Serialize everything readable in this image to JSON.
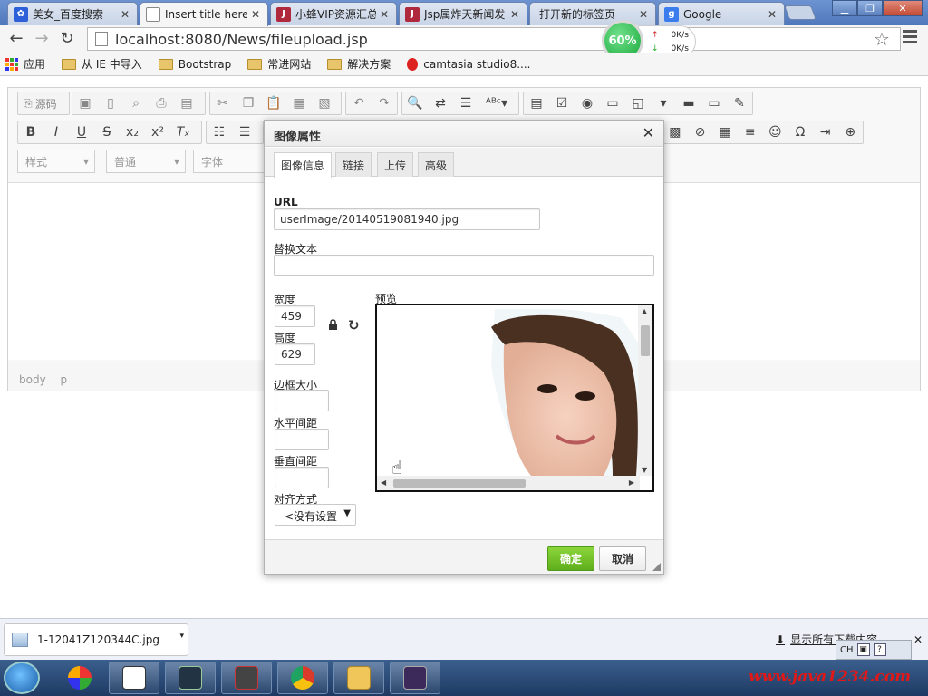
{
  "tabs": [
    {
      "label": "美女_百度搜索",
      "icon": "baidu-paw-icon",
      "color": "#2d5fd8"
    },
    {
      "label": "Insert title here",
      "icon": "page-icon",
      "color": "#ffffff"
    },
    {
      "label": "小蜂VIP资源汇总",
      "icon": "j-icon",
      "color": "#b0283c"
    },
    {
      "label": "Jsp属炸天新闻发",
      "icon": "j-icon",
      "color": "#b0283c"
    },
    {
      "label": "打开新的标签页",
      "icon": "none",
      "color": "#ffffff"
    },
    {
      "label": "Google",
      "icon": "google-g-icon",
      "color": "#3b7ded"
    }
  ],
  "address": {
    "url": "localhost:8080/News/fileupload.jsp"
  },
  "netmeter": {
    "percent": "60%",
    "up": "0K/s",
    "down": "0K/s"
  },
  "bookmarks": {
    "apps": "应用",
    "items": [
      "从 IE 中导入",
      "Bootstrap",
      "常进网站",
      "解决方案"
    ],
    "camtasia": "camtasia studio8...."
  },
  "editor": {
    "source_label": "源码",
    "combos": {
      "style": "样式",
      "format": "普通",
      "font": "字体"
    },
    "path": [
      "body",
      "p"
    ]
  },
  "dialog": {
    "title": "图像属性",
    "tabs": [
      "图像信息",
      "链接",
      "上传",
      "高级"
    ],
    "url_label": "URL",
    "url_value": "userImage/20140519081940.jpg",
    "alt_label": "替换文本",
    "alt_value": "",
    "width_label": "宽度",
    "width_value": "459",
    "height_label": "高度",
    "height_value": "629",
    "border_label": "边框大小",
    "hspace_label": "水平间距",
    "vspace_label": "垂直间距",
    "align_label": "对齐方式",
    "align_value": "<没有设置",
    "preview_label": "预览",
    "ok_label": "确定",
    "cancel_label": "取消"
  },
  "downloads": {
    "file_name": "1-12041Z120344C.jpg",
    "show_all": "显示所有下载内容"
  },
  "ime": {
    "lang": "CH"
  },
  "watermark": "www.java1234.com"
}
